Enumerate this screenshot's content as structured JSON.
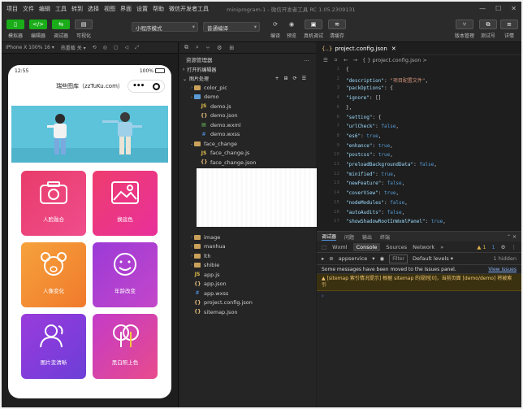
{
  "menu": [
    "项目",
    "文件",
    "编辑",
    "工具",
    "转到",
    "选择",
    "视图",
    "界面",
    "设置",
    "帮助",
    "微信开发者工具"
  ],
  "window_title": "miniprogram-1 - 微信开发者工具 RC 1.05.2309131",
  "toolbar": {
    "left": [
      "模拟器",
      "编辑器",
      "调试器",
      "可视化"
    ],
    "mode": "小程序模式",
    "compile": "普通编译",
    "mid": [
      "编译",
      "预览",
      "真机调试",
      "清缓存"
    ],
    "right": [
      "版本管理",
      "测试号",
      "详情"
    ]
  },
  "simulator": {
    "device": "iPhone X 100% 16 ▾",
    "hot": "热重载 关 ▾",
    "time": "12:55",
    "battery": "100%",
    "title": "瑞些图库（zzTuKu.com）",
    "cards": [
      "人脸融合",
      "换底色",
      "人像变化",
      "年龄改变",
      "图片变清晰",
      "黑白照上色"
    ]
  },
  "explorer": {
    "title": "资源管理器",
    "open_editors": "打开的编辑器",
    "project": "图片处理",
    "items": [
      {
        "label": "color_pic",
        "type": "folder",
        "indent": 1,
        "tw": "›"
      },
      {
        "label": "demo",
        "type": "folder-blue",
        "indent": 1,
        "tw": "⌄"
      },
      {
        "label": "demo.js",
        "type": "js",
        "indent": 2
      },
      {
        "label": "demo.json",
        "type": "json",
        "indent": 2
      },
      {
        "label": "demo.wxml",
        "type": "wxml",
        "indent": 2
      },
      {
        "label": "demo.wxss",
        "type": "wxss",
        "indent": 2
      },
      {
        "label": "face_change",
        "type": "folder",
        "indent": 1,
        "tw": "⌄"
      },
      {
        "label": "face_change.js",
        "type": "js",
        "indent": 2
      },
      {
        "label": "face_change.json",
        "type": "json",
        "indent": 2
      },
      {
        "label": "face_change.wxml",
        "type": "wxml",
        "indent": 2
      },
      {
        "label": "face_change.wxss",
        "type": "wxss",
        "indent": 2
      },
      {
        "label": "",
        "type": "blank",
        "indent": 1
      },
      {
        "label": "",
        "type": "blank",
        "indent": 1
      },
      {
        "label": "",
        "type": "blank",
        "indent": 1
      },
      {
        "label": "",
        "type": "blank",
        "indent": 1
      },
      {
        "label": "",
        "type": "blank",
        "indent": 1
      },
      {
        "label": "image",
        "type": "folder",
        "indent": 1,
        "tw": "›"
      },
      {
        "label": "manhua",
        "type": "folder",
        "indent": 1,
        "tw": "›"
      },
      {
        "label": "lth",
        "type": "folder",
        "indent": 1,
        "tw": "›"
      },
      {
        "label": "shibie",
        "type": "folder",
        "indent": 1,
        "tw": "›"
      },
      {
        "label": "app.js",
        "type": "js",
        "indent": 1
      },
      {
        "label": "app.json",
        "type": "json",
        "indent": 1
      },
      {
        "label": "app.wxss",
        "type": "wxss",
        "indent": 1
      },
      {
        "label": "project.config.json",
        "type": "json",
        "indent": 1
      },
      {
        "label": "sitemap.json",
        "type": "json",
        "indent": 1
      }
    ]
  },
  "editor": {
    "tab": "project.config.json",
    "crumb": "{ } project.config.json >",
    "lines": [
      {
        "n": "1",
        "parts": [
          [
            "p",
            "{"
          ]
        ]
      },
      {
        "n": "2",
        "parts": [
          [
            "k",
            "\"description\""
          ],
          [
            "p",
            ": "
          ],
          [
            "s",
            "\"项目配置文件\""
          ],
          [
            "p",
            ","
          ]
        ]
      },
      {
        "n": "3",
        "parts": [
          [
            "k",
            "\"packOptions\""
          ],
          [
            "p",
            ": {"
          ]
        ]
      },
      {
        "n": "4",
        "parts": [
          [
            "p",
            "  "
          ],
          [
            "k",
            "\"ignore\""
          ],
          [
            "p",
            ": []"
          ]
        ]
      },
      {
        "n": "5",
        "parts": [
          [
            "p",
            "},"
          ]
        ]
      },
      {
        "n": "6",
        "parts": [
          [
            "k",
            "\"setting\""
          ],
          [
            "p",
            ": {"
          ]
        ]
      },
      {
        "n": "7",
        "parts": [
          [
            "p",
            "  "
          ],
          [
            "k",
            "\"urlCheck\""
          ],
          [
            "p",
            ": "
          ],
          [
            "v",
            "false"
          ],
          [
            "p",
            ","
          ]
        ]
      },
      {
        "n": "8",
        "parts": [
          [
            "p",
            "  "
          ],
          [
            "k",
            "\"es6\""
          ],
          [
            "p",
            ": "
          ],
          [
            "v",
            "true"
          ],
          [
            "p",
            ","
          ]
        ]
      },
      {
        "n": "9",
        "parts": [
          [
            "p",
            "  "
          ],
          [
            "k",
            "\"enhance\""
          ],
          [
            "p",
            ": "
          ],
          [
            "v",
            "true"
          ],
          [
            "p",
            ","
          ]
        ]
      },
      {
        "n": "10",
        "parts": [
          [
            "p",
            "  "
          ],
          [
            "k",
            "\"postcss\""
          ],
          [
            "p",
            ": "
          ],
          [
            "v",
            "true"
          ],
          [
            "p",
            ","
          ]
        ]
      },
      {
        "n": "11",
        "parts": [
          [
            "p",
            "  "
          ],
          [
            "k",
            "\"preloadBackgroundData\""
          ],
          [
            "p",
            ": "
          ],
          [
            "v",
            "false"
          ],
          [
            "p",
            ","
          ]
        ]
      },
      {
        "n": "12",
        "parts": [
          [
            "p",
            "  "
          ],
          [
            "k",
            "\"minified\""
          ],
          [
            "p",
            ": "
          ],
          [
            "v",
            "true"
          ],
          [
            "p",
            ","
          ]
        ]
      },
      {
        "n": "13",
        "parts": [
          [
            "p",
            "  "
          ],
          [
            "k",
            "\"newFeature\""
          ],
          [
            "p",
            ": "
          ],
          [
            "v",
            "false"
          ],
          [
            "p",
            ","
          ]
        ]
      },
      {
        "n": "14",
        "parts": [
          [
            "p",
            "  "
          ],
          [
            "k",
            "\"coverView\""
          ],
          [
            "p",
            ": "
          ],
          [
            "v",
            "true"
          ],
          [
            "p",
            ","
          ]
        ]
      },
      {
        "n": "15",
        "parts": [
          [
            "p",
            "  "
          ],
          [
            "k",
            "\"nodeModules\""
          ],
          [
            "p",
            ": "
          ],
          [
            "v",
            "false"
          ],
          [
            "p",
            ","
          ]
        ]
      },
      {
        "n": "16",
        "parts": [
          [
            "p",
            "  "
          ],
          [
            "k",
            "\"autoAudits\""
          ],
          [
            "p",
            ": "
          ],
          [
            "v",
            "false"
          ],
          [
            "p",
            ","
          ]
        ]
      },
      {
        "n": "17",
        "parts": [
          [
            "p",
            "  "
          ],
          [
            "k",
            "\"showShadowRootInWxmlPanel\""
          ],
          [
            "p",
            ": "
          ],
          [
            "v",
            "true"
          ],
          [
            "p",
            ","
          ]
        ]
      }
    ]
  },
  "debugger": {
    "tabs": [
      "调试器",
      "问题",
      "输出",
      "终端"
    ],
    "console_tabs": [
      "Wxml",
      "Console",
      "Sources",
      "Network",
      "»"
    ],
    "warn_count": "▲ 1",
    "err_count": "1",
    "context": "appservice",
    "filter": "Filter",
    "levels": "Default levels ▾",
    "hidden": "1 hidden",
    "msg1": "Some messages have been moved to the Issues panel.",
    "msg1_link": "View issues",
    "msg2": "▲ [sitemap 索引情况提示] 根据 sitemap 的规则[0]，当前页面 [demo/demo] 将被索引",
    "prompt": "›"
  }
}
